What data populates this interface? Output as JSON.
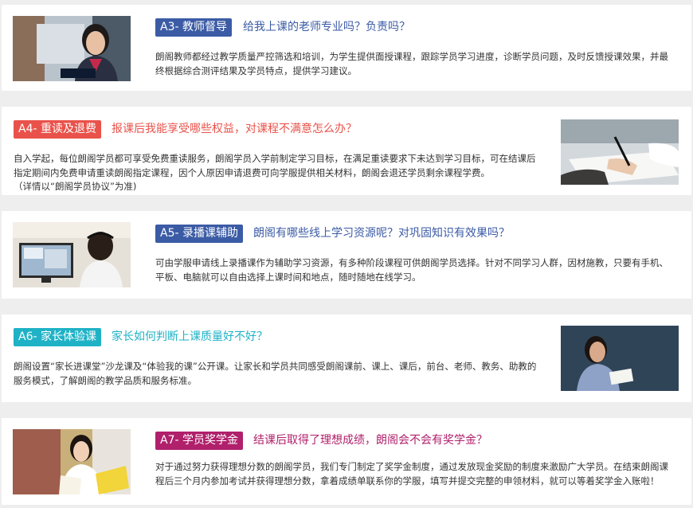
{
  "colors": {
    "page_bg": "#eeeeee",
    "card_bg": "#ffffff",
    "navy": "#3b5ba5",
    "red": "#e9524a",
    "cyan": "#1fb2c6",
    "magenta": "#b0206b"
  },
  "sections": [
    {
      "badge": "A3- 教师督导",
      "question": "给我上课的老师专业吗？负责吗？",
      "description": "朗阁教师都经过教学质量严控筛选和培训，为学生提供面授课程，跟踪学员学习进度，诊断学员问题，及时反馈授课效果，并最终根据综合测评结果及学员特点，提供学习建议。",
      "image_icon": "teacher-portrait-photo"
    },
    {
      "badge": "A4- 重读及退费",
      "question": "报课后我能享受哪些权益，对课程不满意怎么办？",
      "description": "自入学起，每位朗阁学员都可享受免费重读服务，朗阁学员入学前制定学习目标，在满足重读要求下未达到学习目标，可在结课后指定期间内免费申请重读朗阁指定课程，因个人原因申请退费可向学服提供相关材料，朗阁会退还学员剩余课程学费。",
      "note": "（详情以“朗阁学员协议”为准)",
      "image_icon": "signing-document-photo"
    },
    {
      "badge": "A5- 录播课辅助",
      "question": "朗阁有哪些线上学习资源呢？对巩固知识有效果吗？",
      "description": "可由学服申请线上录播课作为辅助学习资源，有多种阶段课程可供朗阁学员选择。针对不同学习人群，因材施教，只要有手机、平板、电脑就可以自由选择上课时间和地点，随时随地在线学习。",
      "image_icon": "online-study-photo"
    },
    {
      "badge": "A6- 家长体验课",
      "question": "家长如何判断上课质量好不好？",
      "description": "朗阁设置“家长进课堂”沙龙课及“体验我的课”公开课。让家长和学员共同感受朗阁课前、课上、课后，前台、老师、教务、助教的服务模式，了解朗阁的教学品质和服务标准。",
      "image_icon": "teacher-blackboard-photo"
    },
    {
      "badge": "A7- 学员奖学金",
      "question": "结课后取得了理想成绩，朗阁会不会有奖学金？",
      "description": "对于通过努力获得理想分数的朗阁学员，我们专门制定了奖学金制度，通过发放现金奖励的制度来激励广大学员。在结束朗阁课程后三个月内参加考试并获得理想分数，拿着成绩单联系你的学服，填写并提交完整的申领材料，就可以等着奖学金入账啦！",
      "image_icon": "happy-student-photo"
    }
  ]
}
